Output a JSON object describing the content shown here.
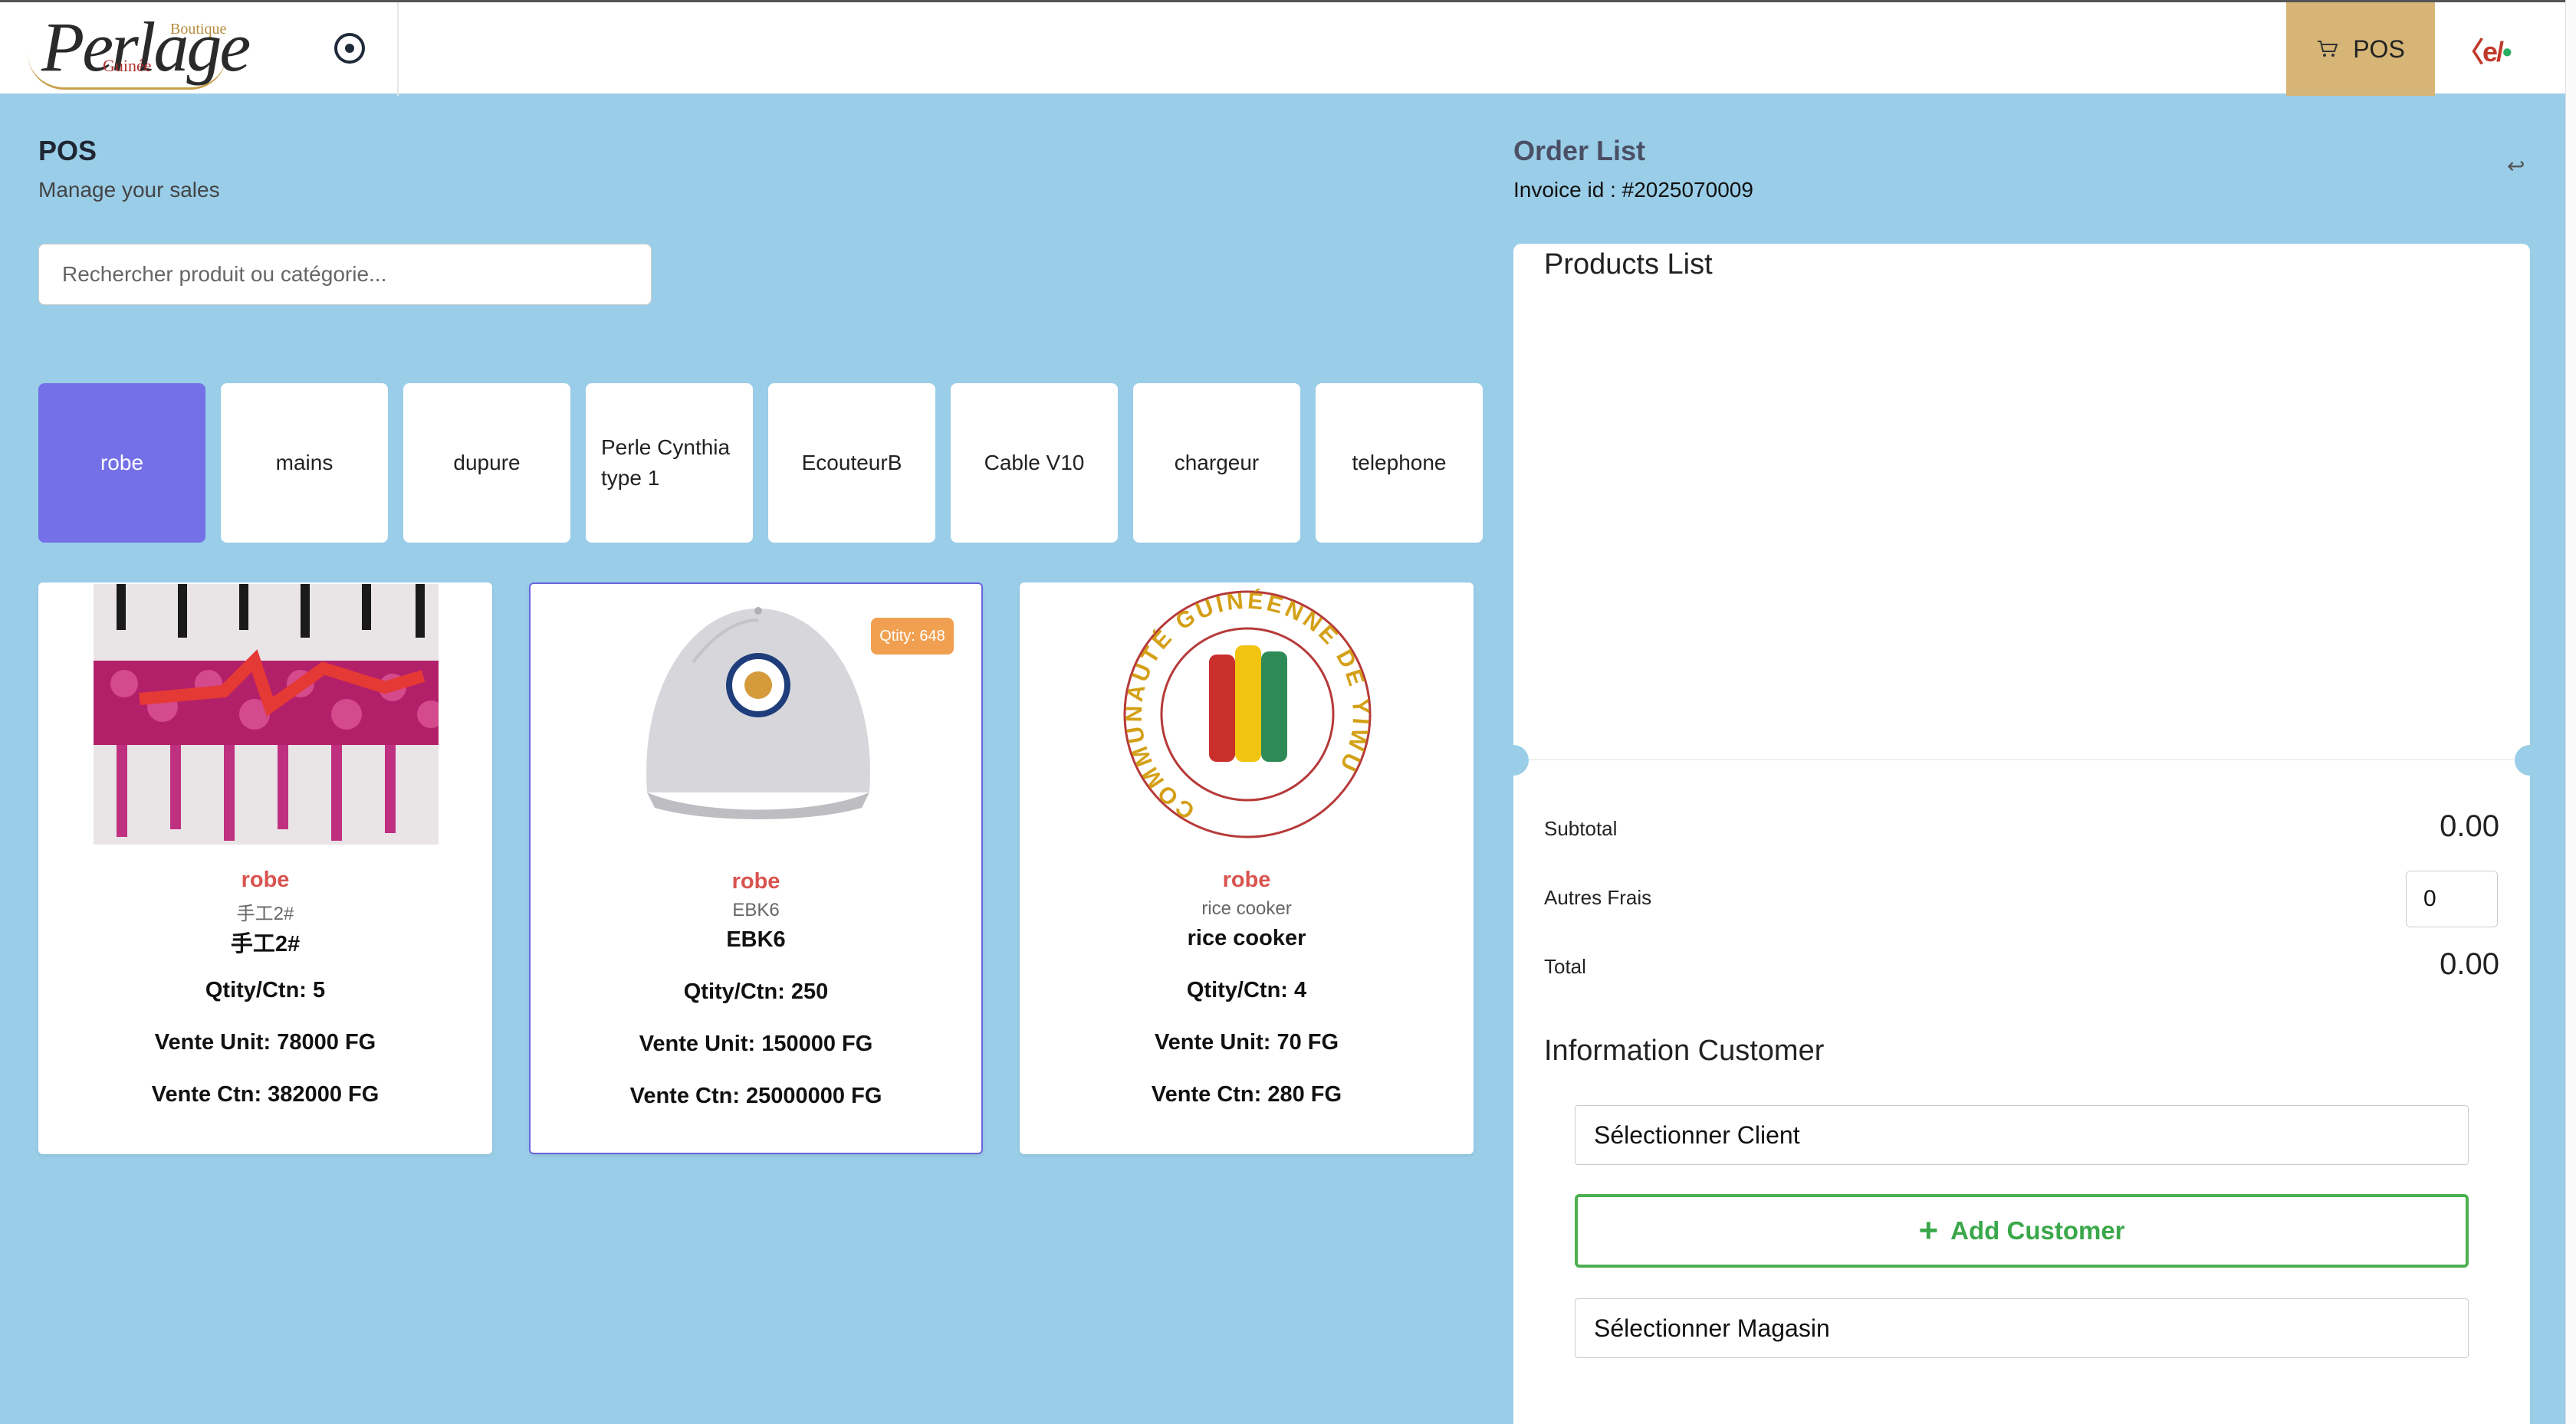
{
  "header": {
    "logo_text": "Perlage",
    "logo_boutique": "Boutique",
    "logo_guinee": "Guinée",
    "pos_label": "POS",
    "brand_mark": "〈e/"
  },
  "page": {
    "title": "POS",
    "subtitle": "Manage your sales",
    "search_placeholder": "Rechercher produit ou catégorie..."
  },
  "categories": [
    {
      "label": "robe",
      "active": true
    },
    {
      "label": "mains"
    },
    {
      "label": "dupure"
    },
    {
      "label": "Perle Cynthia type 1"
    },
    {
      "label": "EcouteurB"
    },
    {
      "label": "Cable V10"
    },
    {
      "label": "chargeur"
    },
    {
      "label": "telephone"
    }
  ],
  "products": [
    {
      "category": "robe",
      "code_small": "手工2#",
      "code": "手工2#",
      "qty_ctn": "Qtity/Ctn: 5",
      "vente_unit": "Vente Unit: 78000 FG",
      "vente_ctn": "Vente Ctn: 382000 FG"
    },
    {
      "category": "robe",
      "code_small": "EBK6",
      "code": "EBK6",
      "qty_ctn": "Qtity/Ctn: 250",
      "vente_unit": "Vente Unit: 150000 FG",
      "vente_ctn": "Vente Ctn: 25000000 FG",
      "badge": "Qtity: 648"
    },
    {
      "category": "robe",
      "code_small": "rice cooker",
      "code": "rice cooker",
      "qty_ctn": "Qtity/Ctn: 4",
      "vente_unit": "Vente Unit: 70 FG",
      "vente_ctn": "Vente Ctn: 280 FG",
      "logo_text": "COMMUNAUTÉ GUINÉENNE DE YIWU"
    }
  ],
  "order": {
    "title": "Order List",
    "invoice": "Invoice id : #2025070009",
    "products_list_title": "Products List",
    "subtotal_label": "Subtotal",
    "subtotal_value": "0.00",
    "autres_frais_label": "Autres Frais",
    "autres_frais_value": "0",
    "total_label": "Total",
    "total_value": "0.00",
    "info_customer_title": "Information Customer",
    "select_client": "Sélectionner Client",
    "add_customer": "Add Customer",
    "select_magasin": "Sélectionner Magasin"
  },
  "colors": {
    "background": "#9acde8",
    "active_category": "#7370e8",
    "pos_tab": "#d6b576",
    "category_text": "#d9534f",
    "add_customer": "#4caf50",
    "badge": "#f0a050"
  }
}
